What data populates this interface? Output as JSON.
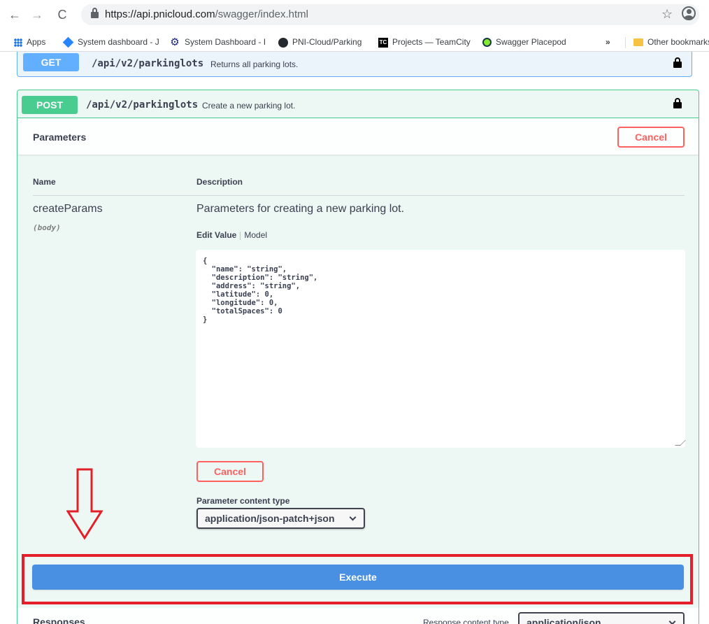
{
  "browser": {
    "url_host": "https://api.pnicloud.com",
    "url_path": "/swagger/index.html",
    "back_glyph": "←",
    "forward_glyph": "→",
    "reload_glyph": "C",
    "star_glyph": "☆",
    "bookmarks": [
      {
        "label": "Apps",
        "icon": "apps-grid-icon"
      },
      {
        "label": "System dashboard - J",
        "icon": "jira-diamond-icon"
      },
      {
        "label": "System Dashboard - I",
        "icon": "dashboard-gear-icon"
      },
      {
        "label": "PNI-Cloud/Parking",
        "icon": "github-icon"
      },
      {
        "label": "Projects — TeamCity",
        "icon": "teamcity-icon"
      },
      {
        "label": "Swagger Placepod",
        "icon": "swagger-icon"
      }
    ],
    "overflow_glyph": "»",
    "other_bookmarks": "Other bookmarks",
    "tc_text": "TC"
  },
  "get_op": {
    "method": "GET",
    "path": "/api/v2/parkinglots",
    "summary": "Returns all parking lots."
  },
  "post_op": {
    "method": "POST",
    "path": "/api/v2/parkinglots",
    "summary": "Create a new parking lot.",
    "parameters_title": "Parameters",
    "cancel_label": "Cancel",
    "col_name": "Name",
    "col_description": "Description",
    "param": {
      "name": "createParams",
      "in": "(body)",
      "description": "Parameters for creating a new parking lot.",
      "tab_edit": "Edit Value",
      "tab_model": "Model",
      "body_value": "{\n  \"name\": \"string\",\n  \"description\": \"string\",\n  \"address\": \"string\",\n  \"latitude\": 0,\n  \"longitude\": 0,\n  \"totalSpaces\": 0\n}"
    },
    "content_type_label": "Parameter content type",
    "content_type_value": "application/json-patch+json",
    "execute_label": "Execute",
    "responses_title": "Responses",
    "response_ct_label": "Response content type",
    "response_ct_value": "application/json"
  },
  "colors": {
    "get": "#61affe",
    "post": "#49cc90",
    "cancel": "#ff6060",
    "execute": "#4990e2",
    "annotation": "#e3202a"
  }
}
